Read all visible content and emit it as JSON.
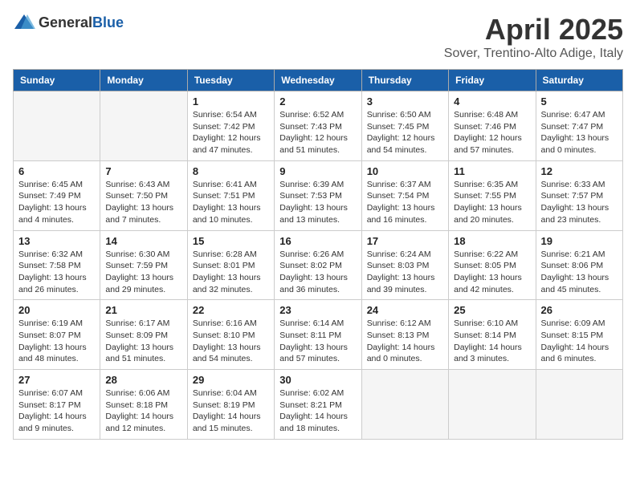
{
  "header": {
    "logo_general": "General",
    "logo_blue": "Blue",
    "month_title": "April 2025",
    "location": "Sover, Trentino-Alto Adige, Italy"
  },
  "weekdays": [
    "Sunday",
    "Monday",
    "Tuesday",
    "Wednesday",
    "Thursday",
    "Friday",
    "Saturday"
  ],
  "weeks": [
    [
      {
        "day": "",
        "empty": true
      },
      {
        "day": "",
        "empty": true
      },
      {
        "day": "1",
        "sunrise": "6:54 AM",
        "sunset": "7:42 PM",
        "daylight": "12 hours and 47 minutes."
      },
      {
        "day": "2",
        "sunrise": "6:52 AM",
        "sunset": "7:43 PM",
        "daylight": "12 hours and 51 minutes."
      },
      {
        "day": "3",
        "sunrise": "6:50 AM",
        "sunset": "7:45 PM",
        "daylight": "12 hours and 54 minutes."
      },
      {
        "day": "4",
        "sunrise": "6:48 AM",
        "sunset": "7:46 PM",
        "daylight": "12 hours and 57 minutes."
      },
      {
        "day": "5",
        "sunrise": "6:47 AM",
        "sunset": "7:47 PM",
        "daylight": "13 hours and 0 minutes."
      }
    ],
    [
      {
        "day": "6",
        "sunrise": "6:45 AM",
        "sunset": "7:49 PM",
        "daylight": "13 hours and 4 minutes."
      },
      {
        "day": "7",
        "sunrise": "6:43 AM",
        "sunset": "7:50 PM",
        "daylight": "13 hours and 7 minutes."
      },
      {
        "day": "8",
        "sunrise": "6:41 AM",
        "sunset": "7:51 PM",
        "daylight": "13 hours and 10 minutes."
      },
      {
        "day": "9",
        "sunrise": "6:39 AM",
        "sunset": "7:53 PM",
        "daylight": "13 hours and 13 minutes."
      },
      {
        "day": "10",
        "sunrise": "6:37 AM",
        "sunset": "7:54 PM",
        "daylight": "13 hours and 16 minutes."
      },
      {
        "day": "11",
        "sunrise": "6:35 AM",
        "sunset": "7:55 PM",
        "daylight": "13 hours and 20 minutes."
      },
      {
        "day": "12",
        "sunrise": "6:33 AM",
        "sunset": "7:57 PM",
        "daylight": "13 hours and 23 minutes."
      }
    ],
    [
      {
        "day": "13",
        "sunrise": "6:32 AM",
        "sunset": "7:58 PM",
        "daylight": "13 hours and 26 minutes."
      },
      {
        "day": "14",
        "sunrise": "6:30 AM",
        "sunset": "7:59 PM",
        "daylight": "13 hours and 29 minutes."
      },
      {
        "day": "15",
        "sunrise": "6:28 AM",
        "sunset": "8:01 PM",
        "daylight": "13 hours and 32 minutes."
      },
      {
        "day": "16",
        "sunrise": "6:26 AM",
        "sunset": "8:02 PM",
        "daylight": "13 hours and 36 minutes."
      },
      {
        "day": "17",
        "sunrise": "6:24 AM",
        "sunset": "8:03 PM",
        "daylight": "13 hours and 39 minutes."
      },
      {
        "day": "18",
        "sunrise": "6:22 AM",
        "sunset": "8:05 PM",
        "daylight": "13 hours and 42 minutes."
      },
      {
        "day": "19",
        "sunrise": "6:21 AM",
        "sunset": "8:06 PM",
        "daylight": "13 hours and 45 minutes."
      }
    ],
    [
      {
        "day": "20",
        "sunrise": "6:19 AM",
        "sunset": "8:07 PM",
        "daylight": "13 hours and 48 minutes."
      },
      {
        "day": "21",
        "sunrise": "6:17 AM",
        "sunset": "8:09 PM",
        "daylight": "13 hours and 51 minutes."
      },
      {
        "day": "22",
        "sunrise": "6:16 AM",
        "sunset": "8:10 PM",
        "daylight": "13 hours and 54 minutes."
      },
      {
        "day": "23",
        "sunrise": "6:14 AM",
        "sunset": "8:11 PM",
        "daylight": "13 hours and 57 minutes."
      },
      {
        "day": "24",
        "sunrise": "6:12 AM",
        "sunset": "8:13 PM",
        "daylight": "14 hours and 0 minutes."
      },
      {
        "day": "25",
        "sunrise": "6:10 AM",
        "sunset": "8:14 PM",
        "daylight": "14 hours and 3 minutes."
      },
      {
        "day": "26",
        "sunrise": "6:09 AM",
        "sunset": "8:15 PM",
        "daylight": "14 hours and 6 minutes."
      }
    ],
    [
      {
        "day": "27",
        "sunrise": "6:07 AM",
        "sunset": "8:17 PM",
        "daylight": "14 hours and 9 minutes."
      },
      {
        "day": "28",
        "sunrise": "6:06 AM",
        "sunset": "8:18 PM",
        "daylight": "14 hours and 12 minutes."
      },
      {
        "day": "29",
        "sunrise": "6:04 AM",
        "sunset": "8:19 PM",
        "daylight": "14 hours and 15 minutes."
      },
      {
        "day": "30",
        "sunrise": "6:02 AM",
        "sunset": "8:21 PM",
        "daylight": "14 hours and 18 minutes."
      },
      {
        "day": "",
        "empty": true
      },
      {
        "day": "",
        "empty": true
      },
      {
        "day": "",
        "empty": true
      }
    ]
  ]
}
